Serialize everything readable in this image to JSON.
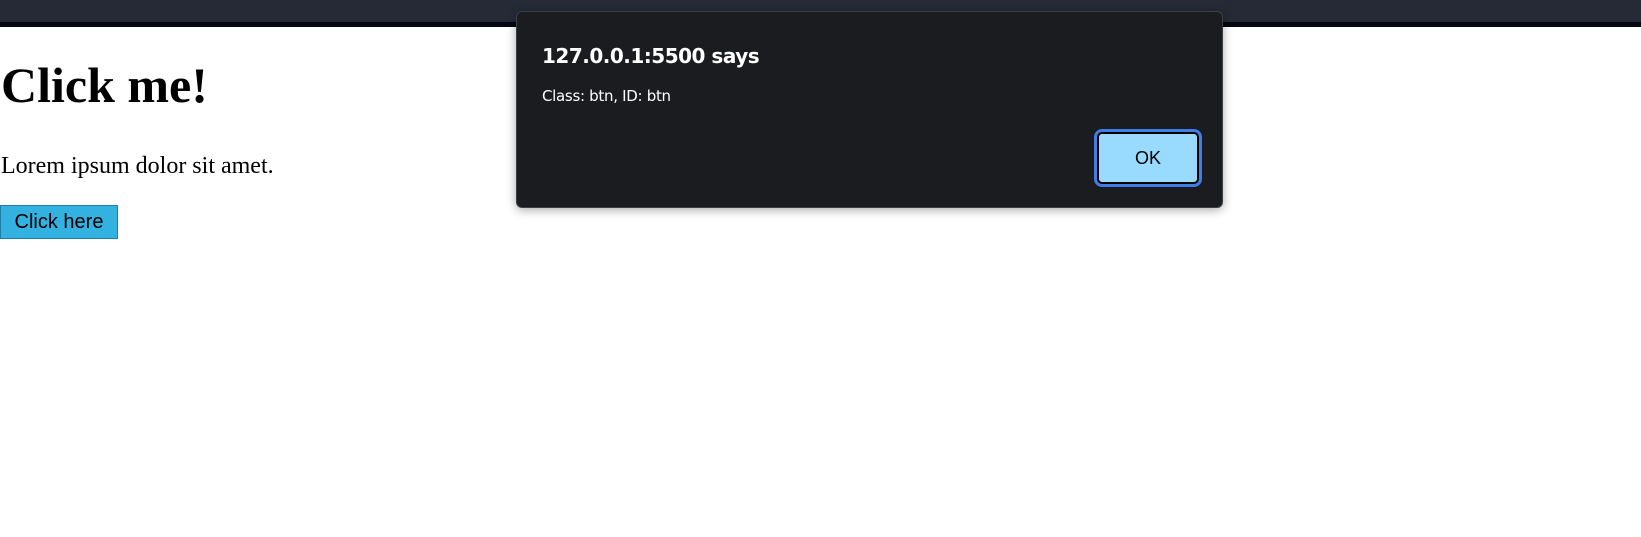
{
  "page": {
    "heading": "Click me!",
    "paragraph": "Lorem ipsum dolor sit amet.",
    "button_label": "Click here"
  },
  "alert": {
    "title": "127.0.0.1:5500 says",
    "message": "Class: btn, ID: btn",
    "ok_label": "OK"
  },
  "colors": {
    "button": "#33b1e0",
    "dialog_bg": "#1a1c20",
    "ok_bg": "#99dbfe",
    "focus_ring": "#3d7ee8"
  }
}
